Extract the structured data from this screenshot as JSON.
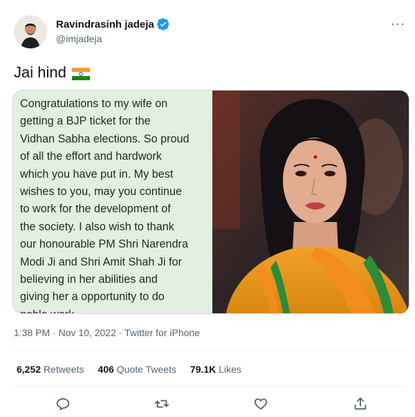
{
  "author": {
    "display_name": "Ravindrasinh jadeja",
    "handle": "@imjadeja",
    "avatar_icon": "user-avatar"
  },
  "tweet": {
    "text": "Jai hind",
    "flag_icon": "india-flag-icon"
  },
  "media": {
    "text_lines": [
      "Congratulations to my wife on",
      "getting a BJP ticket for the",
      "Vidhan Sabha elections. So proud",
      "of all the effort and hardwork",
      "which you have put in. My best",
      "wishes to you, may you continue",
      "to work for the development of",
      "the society. I also wish to thank",
      "our honourable PM Shri Narendra",
      "Modi Ji and Shri Amit Shah Ji for",
      "believing in her abilities and",
      "giving her a opportunity to do",
      "noble work"
    ]
  },
  "meta": {
    "timestamp": "1:38 PM · Nov 10, 2022 · Twitter for iPhone"
  },
  "stats": {
    "retweets_count": "6,252",
    "retweets_label": "Retweets",
    "quotes_count": "406",
    "quotes_label": "Quote Tweets",
    "likes_count": "79.1K",
    "likes_label": "Likes"
  },
  "actions": [
    "reply-icon",
    "retweet-icon",
    "like-icon",
    "share-icon"
  ],
  "colors": {
    "verified": "#1d9bf0",
    "secondary_text": "#536471",
    "media_note_bg": "#e3efe0"
  }
}
